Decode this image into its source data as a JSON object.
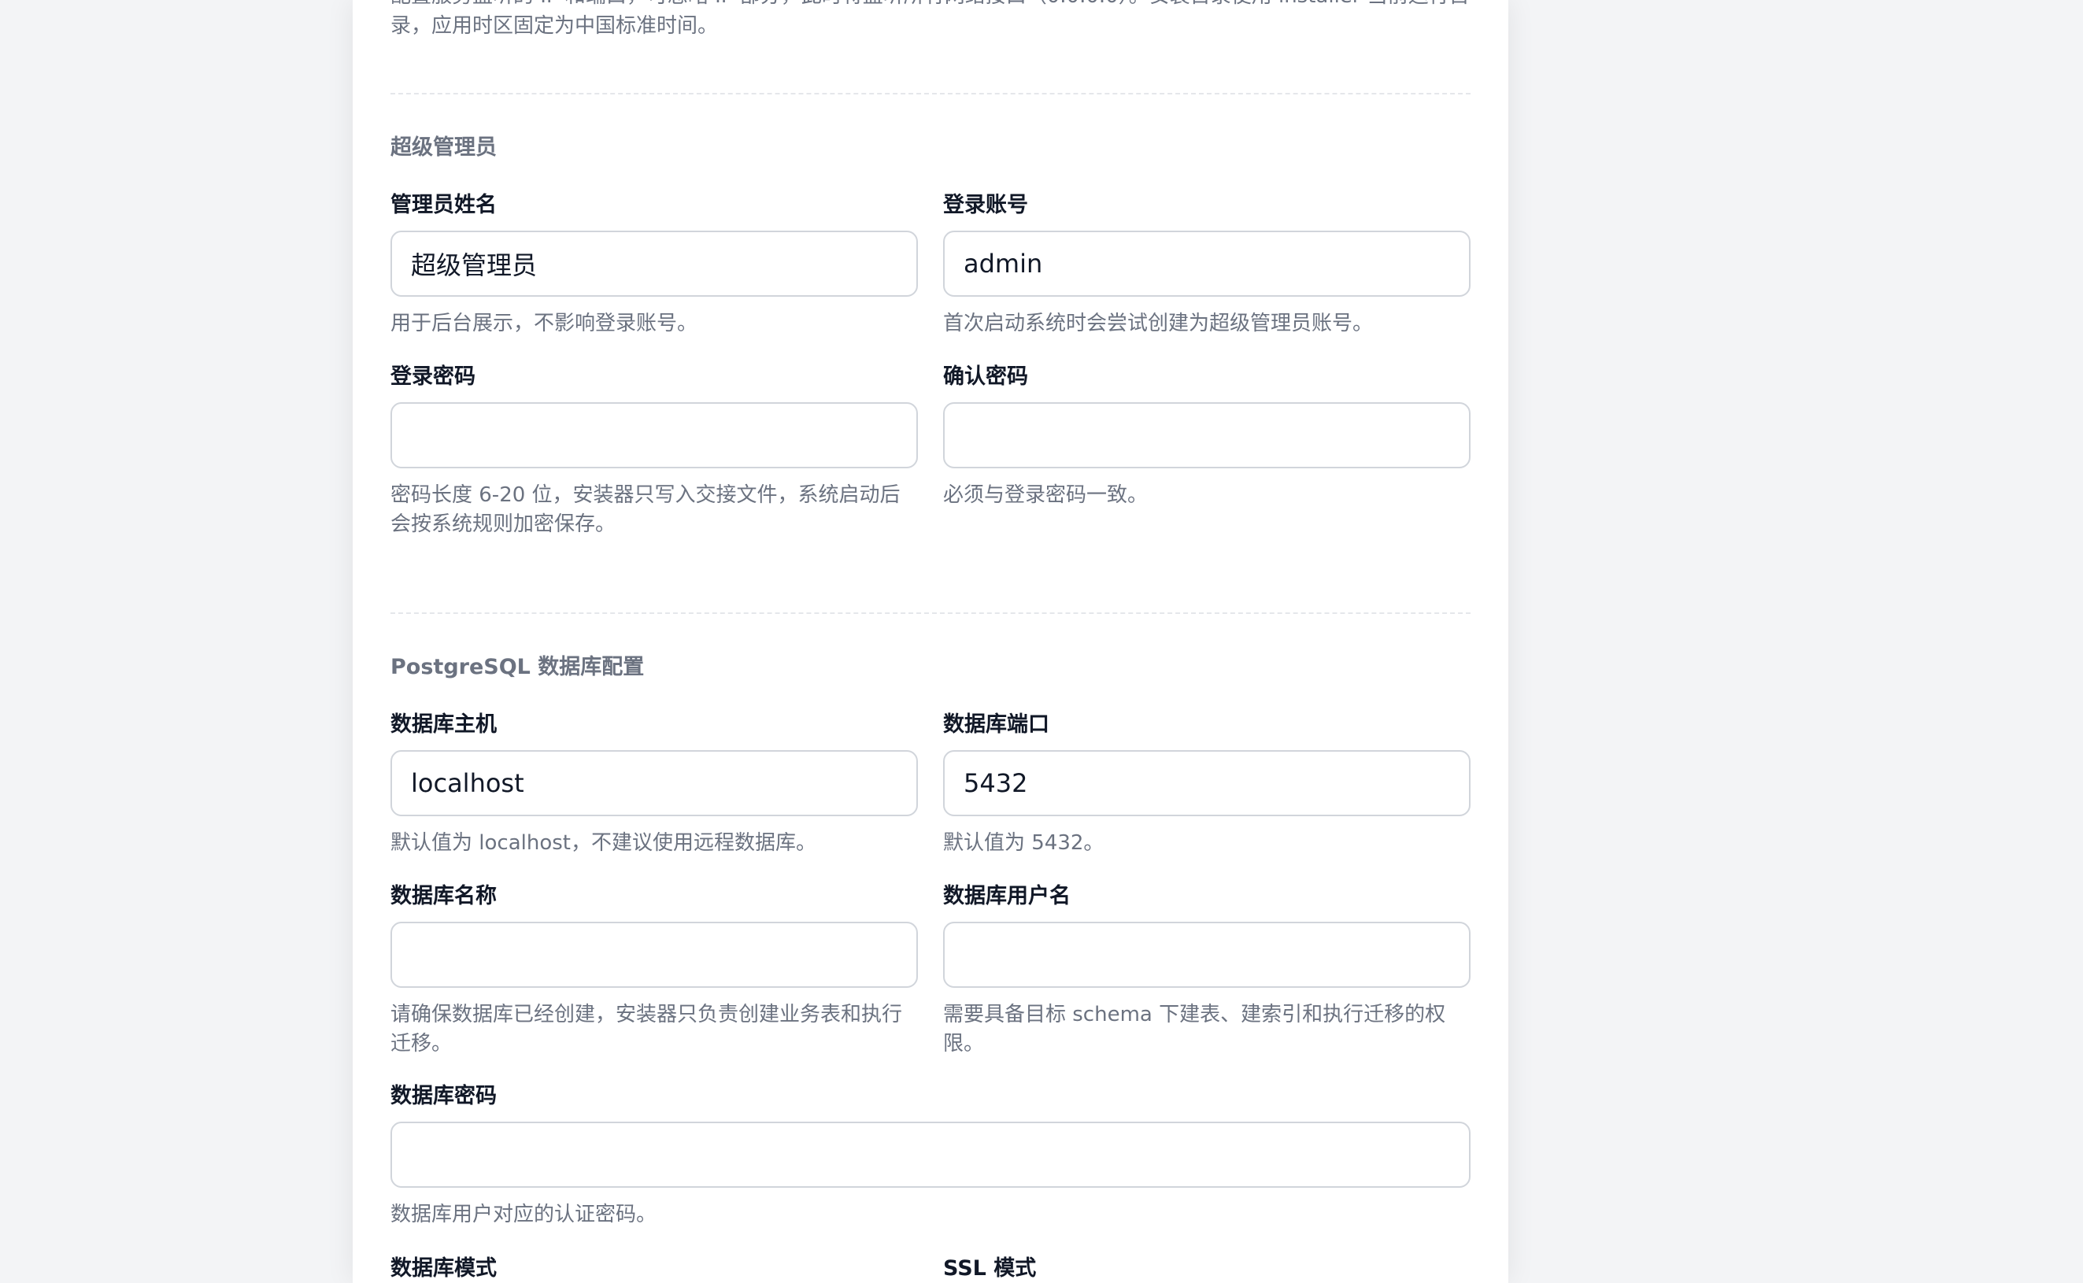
{
  "intro": {
    "text": "配置服务监听的 IP 和端口，可忽略 IP 部分，此时将监听所有网络接口（0.0.0.0）。安装目录使用 installer 当前运行目录，应用时区固定为中国标准时间。"
  },
  "admin_section": {
    "title": "超级管理员",
    "admin_name": {
      "label": "管理员姓名",
      "value": "超级管理员",
      "hint": "用于后台展示，不影响登录账号。"
    },
    "login_account": {
      "label": "登录账号",
      "value": "admin",
      "hint": "首次启动系统时会尝试创建为超级管理员账号。"
    },
    "login_password": {
      "label": "登录密码",
      "value": "",
      "hint": "密码长度 6-20 位，安装器只写入交接文件，系统启动后会按系统规则加密保存。"
    },
    "confirm_password": {
      "label": "确认密码",
      "value": "",
      "hint": "必须与登录密码一致。"
    }
  },
  "db_section": {
    "title": "PostgreSQL 数据库配置",
    "db_host": {
      "label": "数据库主机",
      "value": "localhost",
      "hint": "默认值为 localhost，不建议使用远程数据库。"
    },
    "db_port": {
      "label": "数据库端口",
      "value": "5432",
      "hint": "默认值为 5432。"
    },
    "db_name": {
      "label": "数据库名称",
      "value": "",
      "hint": "请确保数据库已经创建，安装器只负责创建业务表和执行迁移。"
    },
    "db_user": {
      "label": "数据库用户名",
      "value": "",
      "hint": "需要具备目标 schema 下建表、建索引和执行迁移的权限。"
    },
    "db_password": {
      "label": "数据库密码",
      "value": "",
      "hint": "数据库用户对应的认证密码。"
    },
    "db_schema": {
      "label": "数据库模式"
    },
    "ssl_mode": {
      "label": "SSL 模式"
    }
  }
}
